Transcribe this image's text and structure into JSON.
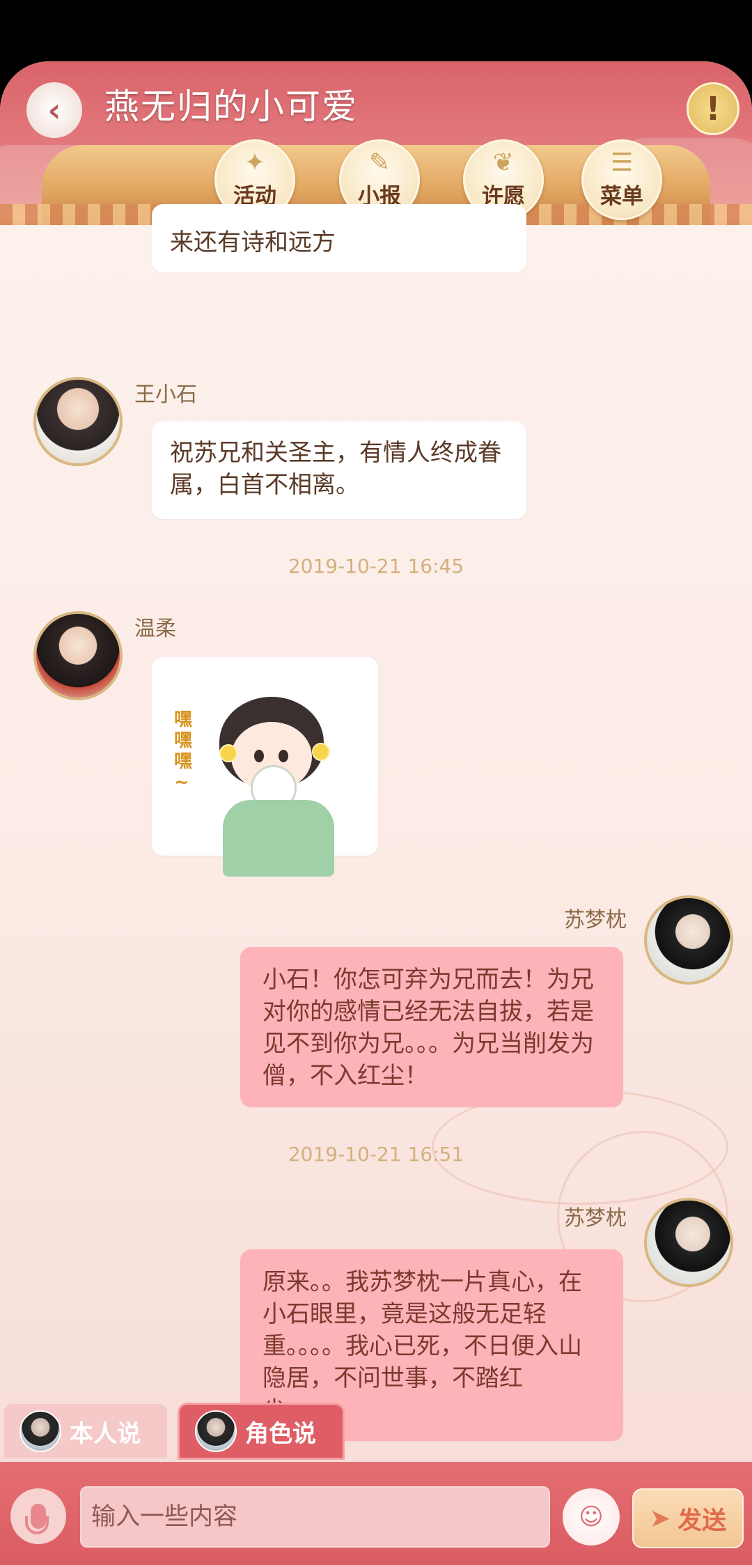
{
  "header": {
    "title": "燕无归的小可爱",
    "alert_symbol": "!",
    "back_symbol": "‹",
    "nav": [
      {
        "label": "活动",
        "icon": "lantern-icon",
        "glyph": "✦"
      },
      {
        "label": "小报",
        "icon": "scroll-icon",
        "glyph": "✎"
      },
      {
        "label": "许愿",
        "icon": "wish-fountain-icon",
        "glyph": "❦"
      },
      {
        "label": "菜单",
        "icon": "menu-icon",
        "glyph": "☰"
      }
    ]
  },
  "messages": [
    {
      "type": "text",
      "side": "left",
      "text": "来还有诗和远方"
    },
    {
      "type": "text",
      "side": "left",
      "sender": "王小石",
      "text": "祝苏兄和关圣主，有情人终成眷属，白首不相离。"
    },
    {
      "type": "timestamp",
      "text": "2019-10-21 16:45"
    },
    {
      "type": "sticker",
      "side": "left",
      "sender": "温柔",
      "sticker_text": "嘿嘿嘿~"
    },
    {
      "type": "text",
      "side": "right",
      "sender": "苏梦枕",
      "text": "小石！你怎可弃为兄而去！为兄对你的感情已经无法自拔，若是见不到你为兄。。。为兄当削发为僧，不入红尘！"
    },
    {
      "type": "timestamp",
      "text": "2019-10-21 16:51"
    },
    {
      "type": "text",
      "side": "right",
      "sender": "苏梦枕",
      "text": "原来。。我苏梦枕一片真心，在小石眼里，竟是这般无足轻重。。。。我心已死，不日便入山隐居，不问世事，不踏红尘。。。。"
    }
  ],
  "tabs": [
    {
      "label": "本人说",
      "active": false
    },
    {
      "label": "角色说",
      "active": true
    }
  ],
  "input": {
    "placeholder": "输入一些内容",
    "value": "",
    "emoji_glyph": "☺",
    "send_label": "发送",
    "send_glyph": "➤"
  },
  "colors": {
    "header": "#d9636a",
    "bubble_pink": "#fdb3b8",
    "bubble_white": "#ffffff",
    "accent_gold": "#d9b781"
  }
}
